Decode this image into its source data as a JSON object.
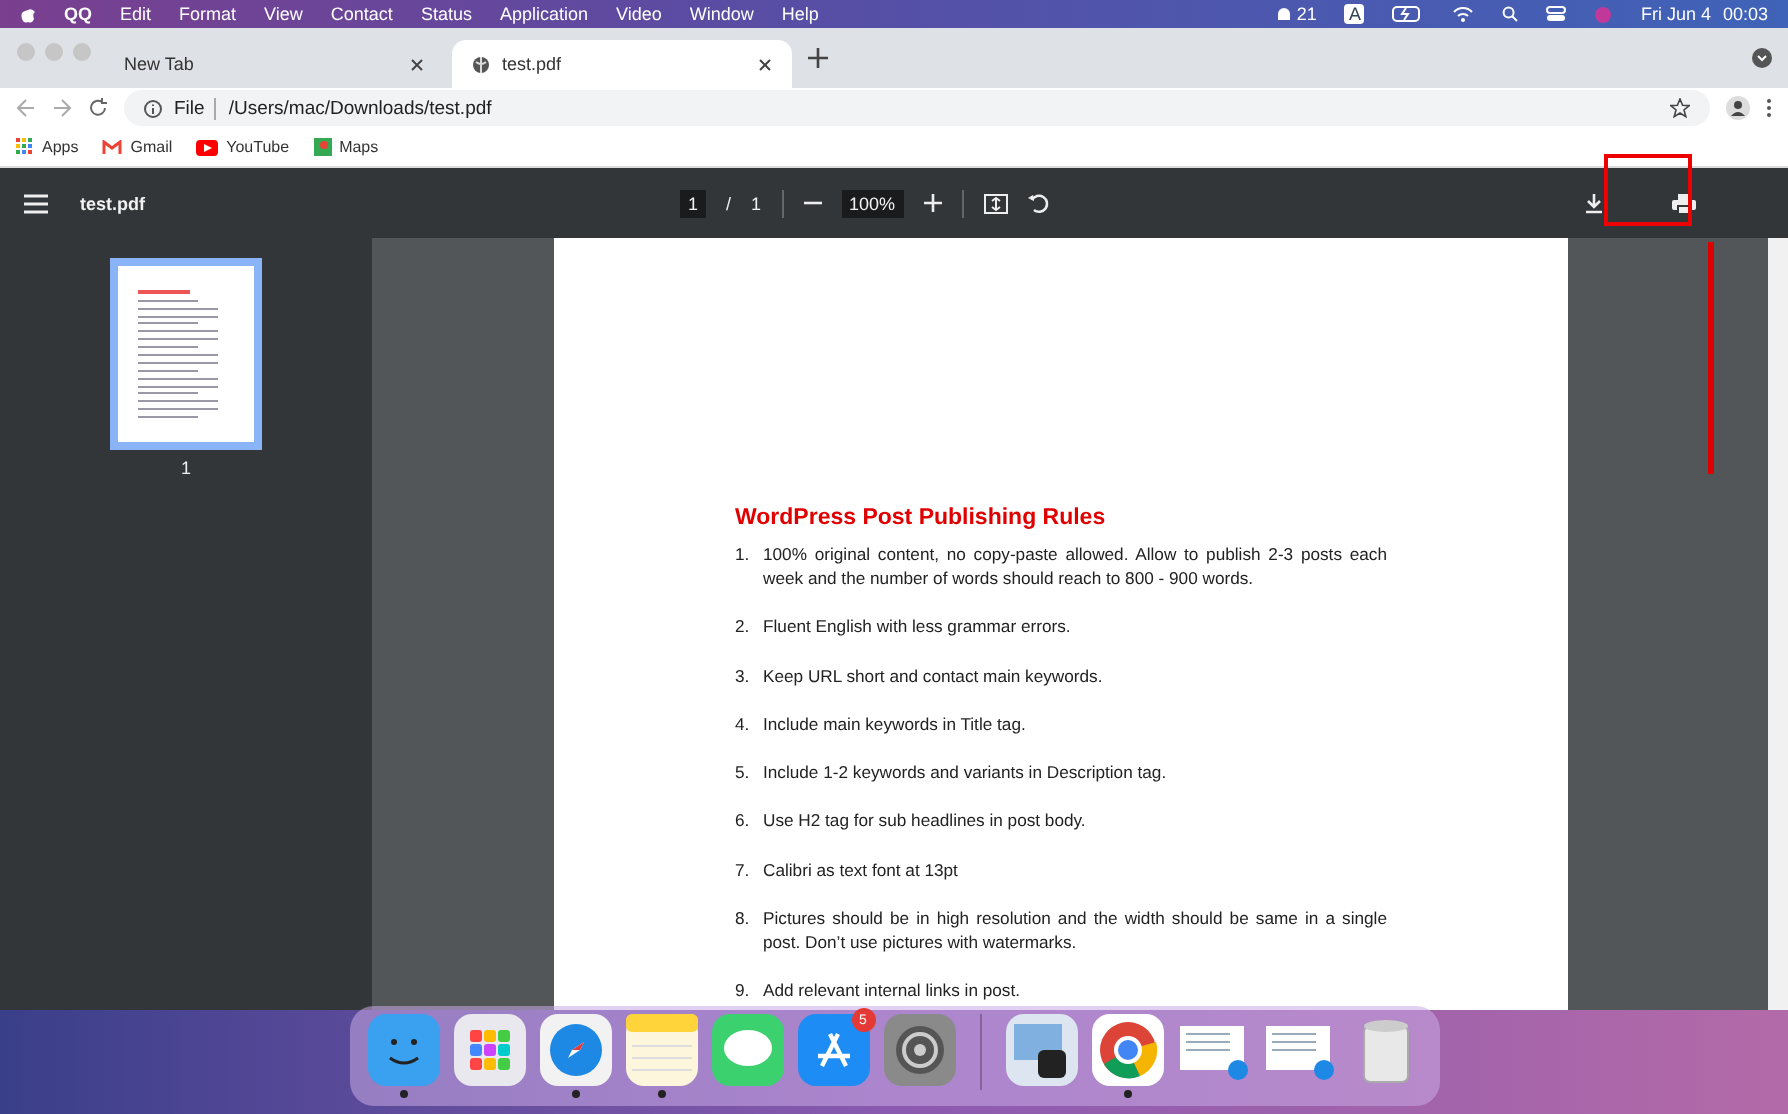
{
  "menu_bar": {
    "app": "QQ",
    "items": [
      "Edit",
      "Format",
      "View",
      "Contact",
      "Status",
      "Application",
      "Video",
      "Window",
      "Help"
    ],
    "notifications": "21",
    "input_source": "A",
    "date": "Fri Jun 4",
    "time": "00:03"
  },
  "tabs": [
    {
      "label": "New Tab",
      "selected": false
    },
    {
      "label": "test.pdf",
      "selected": true
    }
  ],
  "address_bar": {
    "scheme": "File",
    "url": "/Users/mac/Downloads/test.pdf"
  },
  "bookmarks": [
    {
      "kind": "apps",
      "label": "Apps"
    },
    {
      "kind": "gmail",
      "label": "Gmail"
    },
    {
      "kind": "youtube",
      "label": "YouTube"
    },
    {
      "kind": "maps",
      "label": "Maps"
    }
  ],
  "pdf_toolbar": {
    "title": "test.pdf",
    "page": "1",
    "separator": "/",
    "page_count": "1",
    "zoom": "100%"
  },
  "thumbnails": [
    {
      "label": "1",
      "selected": true
    }
  ],
  "document": {
    "title": "WordPress Post Publishing Rules",
    "items": [
      {
        "number": "1.",
        "text": "100% original content, no copy-paste allowed. Allow to publish 2-3 posts each week and the number of words should reach to 800 - 900 words."
      },
      {
        "number": "2.",
        "text": "Fluent English with less grammar errors."
      },
      {
        "number": "3.",
        "text": "Keep URL short and contact main keywords."
      },
      {
        "number": "4.",
        "text": "Include main keywords in Title tag."
      },
      {
        "number": "5.",
        "text": "Include 1-2 keywords and variants in Description tag."
      },
      {
        "number": "6.",
        "text": "Use H2 tag for sub headlines in post body."
      },
      {
        "number": "7.",
        "text": "Calibri as text font at 13pt"
      },
      {
        "number": "8.",
        "text": "Pictures should be in high resolution and the width should be same in a single post. Don’t use pictures with watermarks."
      },
      {
        "number": "9.",
        "text": "Add relevant internal links in post."
      }
    ]
  },
  "dock": [
    {
      "kind": "finder",
      "running": true
    },
    {
      "kind": "launchpad",
      "running": false
    },
    {
      "kind": "safari",
      "running": true
    },
    {
      "kind": "notes",
      "running": true
    },
    {
      "kind": "messages",
      "running": false
    },
    {
      "kind": "appstore",
      "running": false,
      "badge": "5"
    },
    {
      "kind": "settings",
      "running": false
    },
    {
      "kind": "divider"
    },
    {
      "kind": "preview",
      "running": false
    },
    {
      "kind": "chrome",
      "running": true
    },
    {
      "kind": "window",
      "running": false
    },
    {
      "kind": "window",
      "running": false
    },
    {
      "kind": "trash",
      "running": false
    }
  ]
}
